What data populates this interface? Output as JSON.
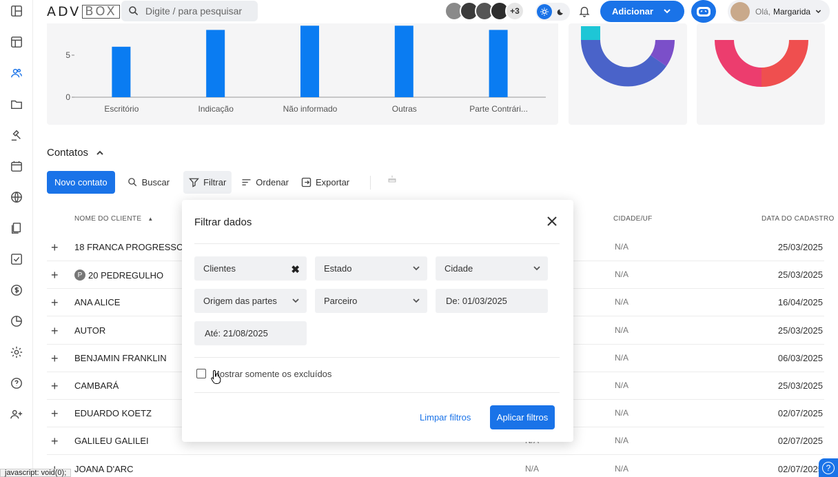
{
  "topbar": {
    "logo_main": "ADV",
    "logo_box": "BOX",
    "search_placeholder": "Digite / para pesquisar",
    "extra_users": "+3",
    "add_label": "Adicionar",
    "greeting": "Olá,",
    "user_name": "Margarida"
  },
  "sidebar": {
    "items": [
      "dashboard-icon",
      "kanban-icon",
      "contacts-icon",
      "folder-icon",
      "gavel-icon",
      "calendar-icon",
      "globe-icon",
      "documents-icon",
      "tasks-icon",
      "money-icon",
      "pie-icon",
      "settings-icon",
      "help-icon",
      "add-user-icon"
    ]
  },
  "chart_data": {
    "type": "bar",
    "categories": [
      "Escritório",
      "Indicação",
      "Não informado",
      "Outras",
      "Parte Contrári..."
    ],
    "values": [
      6,
      8,
      8.5,
      8.5,
      8
    ],
    "yticks": [
      0,
      5
    ],
    "ylim": [
      0,
      8
    ],
    "color": "#0a7cf2"
  },
  "contacts": {
    "title": "Contatos",
    "new_contact": "Novo contato",
    "search": "Buscar",
    "filter": "Filtrar",
    "sort": "Ordenar",
    "export": "Exportar",
    "columns": {
      "name": "NOME DO CLIENTE",
      "city": "CIDADE/UF",
      "date": "DATA DO CADASTRO"
    },
    "rows": [
      {
        "name": "18 FRANCA PROGRESSO",
        "badge": "",
        "col2": "",
        "city": "N/A",
        "date": "25/03/2025"
      },
      {
        "name": "20 PEDREGULHO",
        "badge": "P",
        "col2": "",
        "city": "N/A",
        "date": "25/03/2025"
      },
      {
        "name": "ANA ALICE",
        "badge": "",
        "col2": "",
        "city": "N/A",
        "date": "16/04/2025"
      },
      {
        "name": "AUTOR",
        "badge": "",
        "col2": "",
        "city": "N/A",
        "date": "25/03/2025"
      },
      {
        "name": "BENJAMIN FRANKLIN",
        "badge": "",
        "col2": "",
        "city": "N/A",
        "date": "06/03/2025"
      },
      {
        "name": "CAMBARÁ",
        "badge": "",
        "col2": "",
        "city": "N/A",
        "date": "25/03/2025"
      },
      {
        "name": "EDUARDO KOETZ",
        "badge": "",
        "col2": "",
        "city": "N/A",
        "date": "02/07/2025"
      },
      {
        "name": "GALILEU GALILEI",
        "badge": "",
        "col2": "N/A",
        "city": "N/A",
        "date": "02/07/2025"
      },
      {
        "name": "JOANA D'ARC",
        "badge": "",
        "col2": "N/A",
        "city": "N/A",
        "date": "02/07/2025"
      }
    ]
  },
  "filter_modal": {
    "title": "Filtrar dados",
    "fields": {
      "type": "Clientes",
      "state": "Estado",
      "city": "Cidade",
      "origin": "Origem das partes",
      "partner": "Parceiro",
      "from": "De: 01/03/2025",
      "to": "Até: 21/08/2025"
    },
    "show_deleted": "Mostrar somente os excluídos",
    "clear": "Limpar filtros",
    "apply": "Aplicar filtros"
  },
  "status_bar": "javascript: void(0);"
}
